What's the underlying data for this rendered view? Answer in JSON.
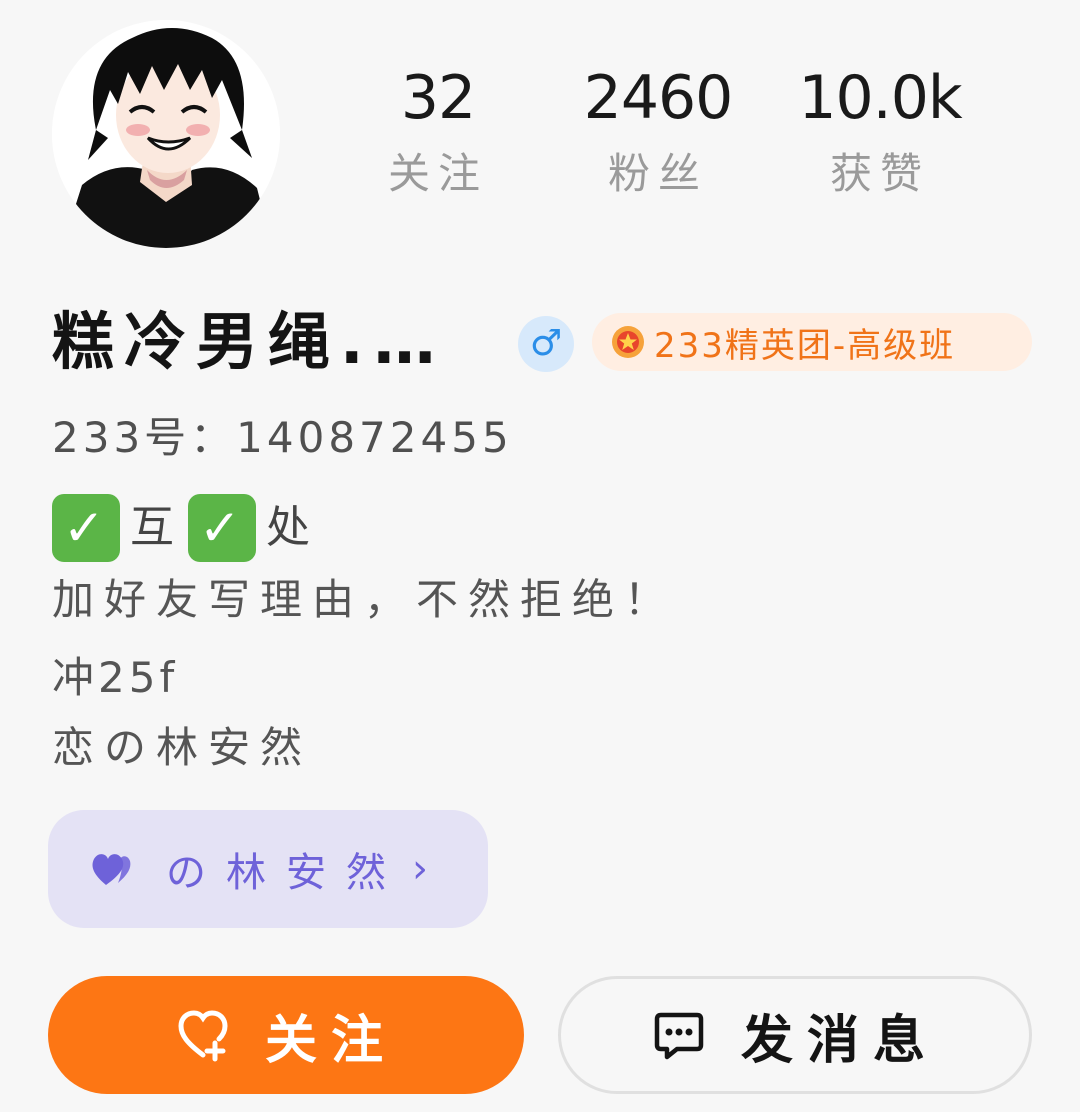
{
  "profile": {
    "name": "糕冷男绳.…",
    "gender_symbol": "♂",
    "badge": "233精英团-高级班",
    "id_line": "233号：140872455",
    "bio": {
      "line1_a": "互",
      "line1_b": "处",
      "line2": "加好友写理由，不然拒绝！",
      "line3": "冲25f",
      "line4": "恋の林安然"
    }
  },
  "stats": [
    {
      "value": "32",
      "label": "关注"
    },
    {
      "value": "2460",
      "label": "粉丝"
    },
    {
      "value": "10.0k",
      "label": "获赞"
    }
  ],
  "relation": {
    "label": "の林安然",
    "chevron": "›"
  },
  "actions": {
    "follow_label": "关注",
    "message_label": "发消息"
  },
  "colors": {
    "accent_orange": "#fd7614",
    "relation_purple": "#6e62d9",
    "gender_blue": "#2b8ee8",
    "check_green": "#5bb547"
  },
  "icons": {
    "avatar": "anime-avatar",
    "badge": "medal-icon",
    "check": "check-mark-icon",
    "relation": "double-heart-icon",
    "follow": "heart-plus-icon",
    "message": "chat-bubble-icon"
  }
}
